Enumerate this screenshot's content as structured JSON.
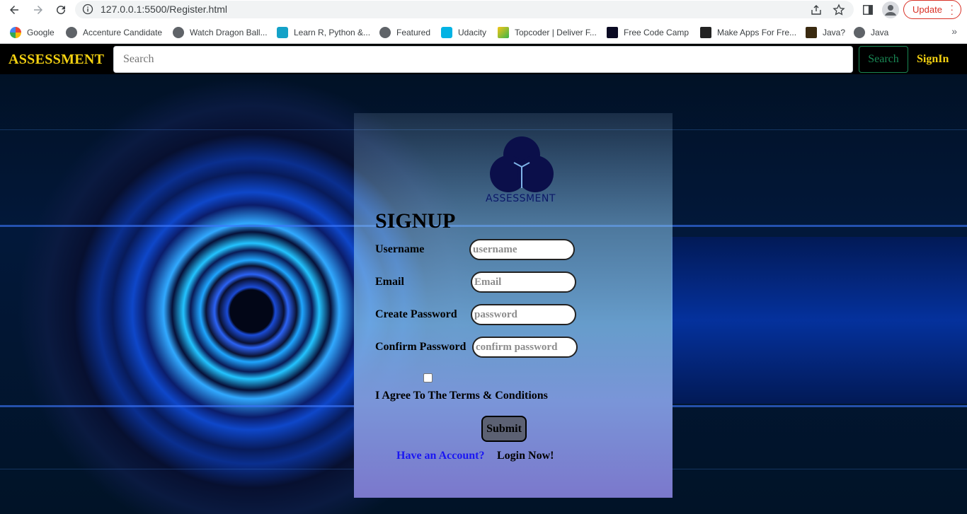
{
  "browser": {
    "url": "127.0.0.1:5500/Register.html",
    "update_label": "Update"
  },
  "bookmarks": [
    {
      "label": "Google",
      "color": "#4285f4"
    },
    {
      "label": "Accenture Candidate",
      "color": "#5f6368"
    },
    {
      "label": "Watch Dragon Ball...",
      "color": "#5f6368"
    },
    {
      "label": "Learn R, Python &...",
      "color": "#14a2c8"
    },
    {
      "label": "Featured",
      "color": "#5f6368"
    },
    {
      "label": "Udacity",
      "color": "#02b3e4"
    },
    {
      "label": "Topcoder | Deliver F...",
      "color": "#f5c518"
    },
    {
      "label": "Free Code Camp",
      "color": "#0a0a23"
    },
    {
      "label": "Make Apps For Fre...",
      "color": "#222222"
    },
    {
      "label": "Java?",
      "color": "#3a2a10"
    },
    {
      "label": "Java",
      "color": "#5f6368"
    }
  ],
  "navbar": {
    "brand": "ASSESSMENT",
    "search_placeholder": "Search",
    "search_button": "Search",
    "signin": "SignIn"
  },
  "form": {
    "logo_text": "ASSESSMENT",
    "title": "SIGNUP",
    "fields": [
      {
        "label": "Username",
        "placeholder": "username"
      },
      {
        "label": "Email",
        "placeholder": "Email"
      },
      {
        "label": "Create Password",
        "placeholder": "password"
      },
      {
        "label": "Confirm Password",
        "placeholder": "confirm password"
      }
    ],
    "agree_label": "I Agree To The Terms & Conditions",
    "submit_label": "Submit",
    "have_account": "Have an Account?",
    "login_now": "Login Now!"
  },
  "colors": {
    "brand": "#f5d211",
    "search_button": "#198754",
    "link": "#1a16f2",
    "update": "#d93025"
  }
}
